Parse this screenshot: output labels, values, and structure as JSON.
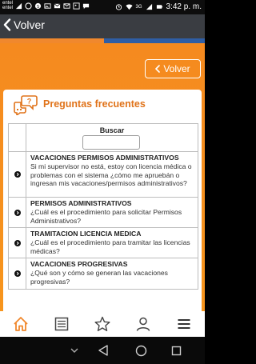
{
  "status_bar": {
    "carrier_top": "entel",
    "carrier_bottom": "entel",
    "network": "3G",
    "battery": "",
    "time": "3:42 p. m."
  },
  "appbar": {
    "back_label": "Volver"
  },
  "content": {
    "volver_button": "Volver",
    "card_title": "Preguntas frecuentes",
    "search_label": "Buscar",
    "search_value": "",
    "faqs": [
      {
        "title": "VACACIONES PERMISOS ADMINISTRATIVOS",
        "text": "Si mi supervisor no está, estoy con licencia médica o problemas con el sistema ¿cómo me apruebán o ingresan mis vacaciones/permisos administrativos?"
      },
      {
        "title": "PERMISOS ADMINISTRATIVOS",
        "text": "¿Cuál es el procedimiento para solicitar Permisos Administrativos?"
      },
      {
        "title": "TRAMITACION LICENCIA MEDICA",
        "text": "¿Cuál es el procedimiento para tramitar las licencias médicas?"
      },
      {
        "title": "VACACIONES PROGRESIVAS",
        "text": "¿Qué son y cómo se generan las vacaciones progresivas?"
      }
    ]
  },
  "bottom_nav": {
    "items": [
      "home-icon",
      "list-icon",
      "star-icon",
      "user-icon",
      "menu-icon"
    ]
  },
  "colors": {
    "orange": "#f58a1f",
    "title_orange": "#e0731a",
    "appbar": "#3a3d42",
    "blue_stripe": "#2f5ea5"
  }
}
